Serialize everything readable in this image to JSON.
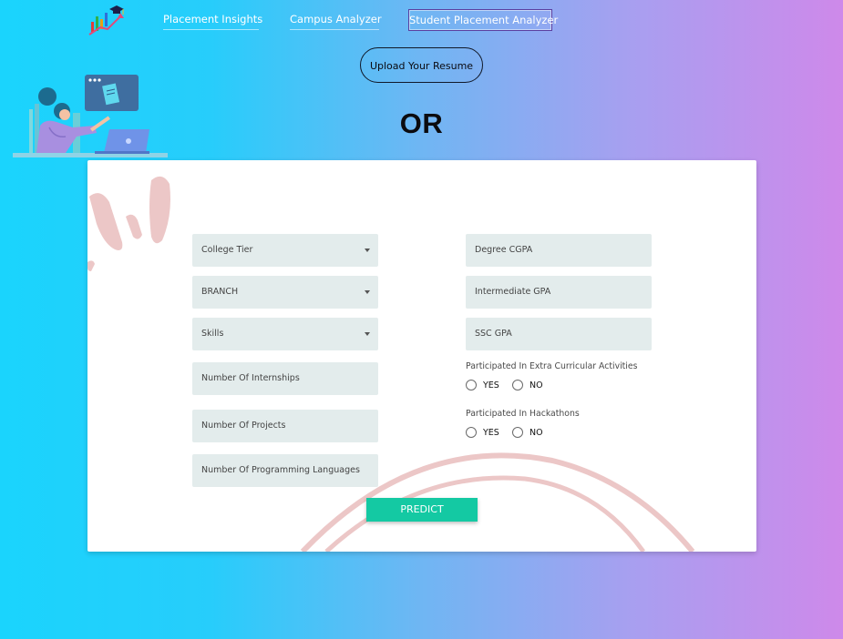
{
  "nav": {
    "links": [
      {
        "label": "Placement Insights"
      },
      {
        "label": "Campus Analyzer"
      },
      {
        "label": "Student Placement Analyzer"
      }
    ]
  },
  "upload_label": "Upload Your Resume",
  "or_label": "OR",
  "form": {
    "left_fields": [
      {
        "label": "College Tier",
        "type": "select"
      },
      {
        "label": "BRANCH",
        "type": "select"
      },
      {
        "label": "Skills",
        "type": "select"
      },
      {
        "label": "Number Of Internships",
        "type": "input"
      },
      {
        "label": "Number Of Projects",
        "type": "input"
      },
      {
        "label": "Number Of Programming Languages",
        "type": "input"
      }
    ],
    "right_fields": [
      {
        "label": "Degree CGPA",
        "type": "input"
      },
      {
        "label": "Intermediate GPA",
        "type": "input"
      },
      {
        "label": "SSC GPA",
        "type": "input"
      }
    ],
    "questions": [
      {
        "label": "Participated In Extra Curricular Activities",
        "options": [
          "YES",
          "NO"
        ]
      },
      {
        "label": "Participated In Hackathons",
        "options": [
          "YES",
          "NO"
        ]
      }
    ],
    "submit_label": "PREDICT"
  },
  "colors": {
    "accent": "#14c9a3",
    "field_bg": "#e3ecec",
    "gradient_start": "#1ad4fd",
    "gradient_end": "#ce89ea"
  }
}
